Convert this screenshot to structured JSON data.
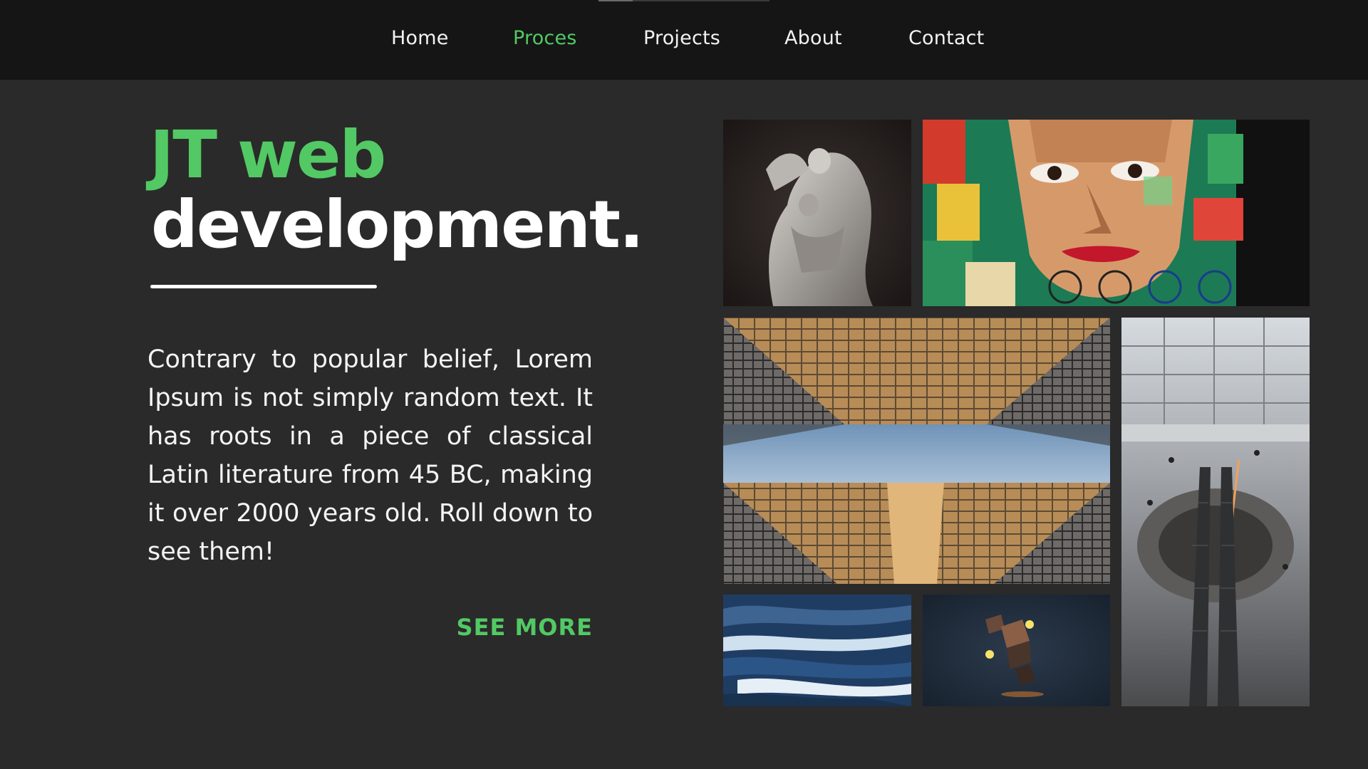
{
  "nav": {
    "items": [
      {
        "label": "Home",
        "active": false
      },
      {
        "label": "Proces",
        "active": true
      },
      {
        "label": "Projects",
        "active": false
      },
      {
        "label": "About",
        "active": false
      },
      {
        "label": "Contact",
        "active": false
      }
    ]
  },
  "hero": {
    "title_line1": "JT web",
    "title_line2": "development.",
    "body": "Contrary to popular belief, Lorem Ipsum is not simply random text. It has roots in a piece of classical Latin literature from 45 BC, making it over 2000 years old. Roll down to see them!",
    "cta_label": "SEE MORE"
  },
  "gallery": {
    "images": [
      "statue-photo",
      "street-mural-photo",
      "glass-buildings-photo",
      "mall-escalator-photo",
      "ocean-waves-photo",
      "floating-cubes-photo"
    ]
  },
  "colors": {
    "accent": "#52c964",
    "nav_background": "#151515",
    "page_background": "#2a2a2a",
    "text": "#ffffff"
  }
}
